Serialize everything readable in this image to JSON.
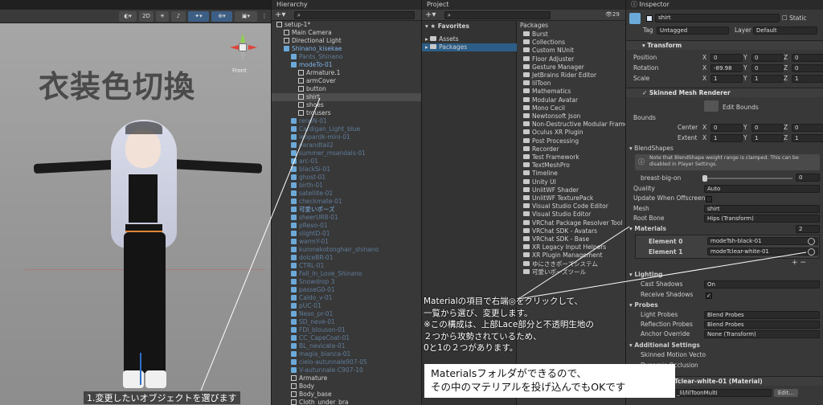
{
  "scene": {
    "view_2d": "2D",
    "persp": "Front",
    "title_overlay": "衣装色切換",
    "caption": "1.変更したいオブジェクトを選びます"
  },
  "hierarchy": {
    "title": "Hierarchy",
    "search_placeholder": "All",
    "items": [
      {
        "label": "setup-1*",
        "indent": 0,
        "type": "scene"
      },
      {
        "label": "Main Camera",
        "indent": 1,
        "type": "obj"
      },
      {
        "label": "Directional Light",
        "indent": 1,
        "type": "obj"
      },
      {
        "label": "Shinano_kisekae",
        "indent": 1,
        "type": "prefab"
      },
      {
        "label": "Pants_Shinano",
        "indent": 2,
        "type": "prefab",
        "dim": true
      },
      {
        "label": "modeTo-01",
        "indent": 2,
        "type": "prefab"
      },
      {
        "label": "Armature.1",
        "indent": 3,
        "type": "obj"
      },
      {
        "label": "armCover",
        "indent": 3,
        "type": "obj"
      },
      {
        "label": "button",
        "indent": 3,
        "type": "obj"
      },
      {
        "label": "shirt",
        "indent": 3,
        "type": "obj",
        "selected": true
      },
      {
        "label": "shoes",
        "indent": 3,
        "type": "obj"
      },
      {
        "label": "trousers",
        "indent": 3,
        "type": "obj"
      },
      {
        "label": "reneN-01",
        "indent": 2,
        "type": "prefab",
        "dim": true
      },
      {
        "label": "Cardigan_Light_blue",
        "indent": 2,
        "type": "prefab",
        "dim": true
      },
      {
        "label": "leopardk-mini-01",
        "indent": 2,
        "type": "prefab",
        "dim": true
      },
      {
        "label": "earandtail2",
        "indent": 2,
        "type": "prefab",
        "dim": true
      },
      {
        "label": "summer_msandals-01",
        "indent": 2,
        "type": "prefab",
        "dim": true
      },
      {
        "label": "arc-01",
        "indent": 2,
        "type": "prefab",
        "dim": true
      },
      {
        "label": "blackSi-01",
        "indent": 2,
        "type": "prefab",
        "dim": true
      },
      {
        "label": "ghost-01",
        "indent": 2,
        "type": "prefab",
        "dim": true
      },
      {
        "label": "birth-01",
        "indent": 2,
        "type": "prefab",
        "dim": true
      },
      {
        "label": "satellite-01",
        "indent": 2,
        "type": "prefab",
        "dim": true
      },
      {
        "label": "checkmate-01",
        "indent": 2,
        "type": "prefab",
        "dim": true
      },
      {
        "label": "可愛いポーズ",
        "indent": 2,
        "type": "prefab"
      },
      {
        "label": "sheerUR8-01",
        "indent": 2,
        "type": "prefab",
        "dim": true
      },
      {
        "label": "pRevo-01",
        "indent": 2,
        "type": "prefab",
        "dim": true
      },
      {
        "label": "slightD-01",
        "indent": 2,
        "type": "prefab",
        "dim": true
      },
      {
        "label": "warmY-01",
        "indent": 2,
        "type": "prefab",
        "dim": true
      },
      {
        "label": "kuronekotonghair_shinano",
        "indent": 2,
        "type": "prefab",
        "dim": true
      },
      {
        "label": "dolceBR-01",
        "indent": 2,
        "type": "prefab",
        "dim": true
      },
      {
        "label": "CTRL-01",
        "indent": 2,
        "type": "prefab",
        "dim": true
      },
      {
        "label": "Fall_In_Love_Shinano",
        "indent": 2,
        "type": "prefab",
        "dim": true
      },
      {
        "label": "Snowdrop 3",
        "indent": 2,
        "type": "prefab",
        "dim": true
      },
      {
        "label": "passeG0-01",
        "indent": 2,
        "type": "prefab",
        "dim": true
      },
      {
        "label": "Caldo_v-01",
        "indent": 2,
        "type": "prefab",
        "dim": true
      },
      {
        "label": "pUC-01",
        "indent": 2,
        "type": "prefab",
        "dim": true
      },
      {
        "label": "Nexo_pr-01",
        "indent": 2,
        "type": "prefab",
        "dim": true
      },
      {
        "label": "SD_neve-01",
        "indent": 2,
        "type": "prefab",
        "dim": true
      },
      {
        "label": "FDI_blouson-01",
        "indent": 2,
        "type": "prefab",
        "dim": true
      },
      {
        "label": "CC_CapeCoat-01",
        "indent": 2,
        "type": "prefab",
        "dim": true
      },
      {
        "label": "BL_nevicate-01",
        "indent": 2,
        "type": "prefab",
        "dim": true
      },
      {
        "label": "magia_bianca-01",
        "indent": 2,
        "type": "prefab",
        "dim": true
      },
      {
        "label": "cielo-autunnale907-05",
        "indent": 2,
        "type": "prefab",
        "dim": true
      },
      {
        "label": "V-autunnale-C907-10",
        "indent": 2,
        "type": "prefab",
        "dim": true
      },
      {
        "label": "Armature",
        "indent": 2,
        "type": "obj"
      },
      {
        "label": "Body",
        "indent": 2,
        "type": "obj"
      },
      {
        "label": "Body_base",
        "indent": 2,
        "type": "obj"
      },
      {
        "label": "Cloth_under_bra",
        "indent": 2,
        "type": "obj"
      }
    ]
  },
  "project": {
    "title": "Project",
    "favorites": "Favorites",
    "assets": "Assets",
    "packages": "Packages",
    "packages_header": "Packages",
    "count": "29",
    "items": [
      "Burst",
      "Collections",
      "Custom NUnit",
      "Floor Adjuster",
      "Gesture Manager",
      "JetBrains Rider Editor",
      "lilToon",
      "Mathematics",
      "Modular Avatar",
      "Mono Cecil",
      "Newtonsoft Json",
      "Non-Destructive Modular Frame",
      "Oculus XR Plugin",
      "Post Processing",
      "Recorder",
      "Test Framework",
      "TextMeshPro",
      "Timeline",
      "Unity UI",
      "UnlitWF Shader",
      "UnlitWF TexturePack",
      "Visual Studio Code Editor",
      "Visual Studio Editor",
      "VRChat Package Resolver Tool",
      "VRChat SDK - Avatars",
      "VRChat SDK - Base",
      "XR Legacy Input Helpers",
      "XR Plugin Management",
      "ゆにさきポーズシステム",
      "可愛いポーズツール"
    ]
  },
  "inspector": {
    "title": "Inspector",
    "name": "shirt",
    "static": "Static",
    "tag_label": "Tag",
    "tag": "Untagged",
    "layer_label": "Layer",
    "layer": "Default",
    "transform": {
      "title": "Transform",
      "position": "Position",
      "rotation": "Rotation",
      "scale": "Scale",
      "pos": [
        "0",
        "0",
        "0"
      ],
      "rot": [
        "-89.98",
        "0",
        "0"
      ],
      "scl": [
        "1",
        "1",
        "1"
      ]
    },
    "smr": {
      "title": "Skinned Mesh Renderer",
      "edit_bounds": "Edit Bounds",
      "bounds": "Bounds",
      "center": "Center",
      "extent": "Extent",
      "center_v": [
        "0",
        "0",
        "0"
      ],
      "extent_v": [
        "1",
        "1",
        "1"
      ],
      "blendshapes": "BlendShapes",
      "blend_note": "Note that BlendShape weight range is clamped. This can be disabled in Player Settings.",
      "breast": "breast-big-on",
      "breast_v": "0",
      "quality": "Quality",
      "quality_v": "Auto",
      "update": "Update When Offscreen",
      "mesh": "Mesh",
      "mesh_v": "shirt",
      "root": "Root Bone",
      "root_v": "Hips (Transform)",
      "materials": "Materials",
      "materials_count": "2",
      "el0": "Element 0",
      "el0_v": "modeTsh-black-01",
      "el1": "Element 1",
      "el1_v": "modeTclear-white-01",
      "lighting": "Lighting",
      "cast": "Cast Shadows",
      "cast_v": "On",
      "receive": "Receive Shadows",
      "probes": "Probes",
      "light_probes": "Light Probes",
      "light_probes_v": "Blend Probes",
      "refl": "Reflection Probes",
      "refl_v": "Blend Probes",
      "anchor": "Anchor Override",
      "anchor_v": "None (Transform)",
      "additional": "Additional Settings",
      "motion": "Skinned Motion Vecto",
      "occlusion": "Dynamic Occlusion",
      "material_footer": "Tclear-white-01 (Material)",
      "shader": "_lil/lilToonMulti",
      "edit": "Edit..."
    }
  },
  "annotation": {
    "main": "Materialの項目で右端◎をクリックして、\n一覧から選び、変更します。\n※この構成は、上部Lace部分と不透明生地の\n２つから攻勢されているため、\n0と1の２つがあります。",
    "box": "Materialsフォルダができるので、\nその中のマテリアルを投げ込んでもOKです"
  },
  "colors": {
    "accent": "#2c5d87",
    "selected": "#4d4d4d",
    "prefab": "#6aa9d8"
  }
}
